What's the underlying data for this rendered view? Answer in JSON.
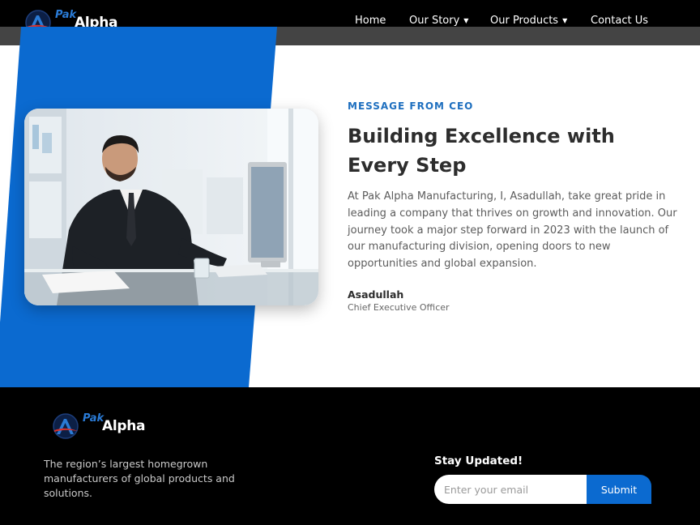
{
  "brand": {
    "word1": "Pak",
    "word2": "Alpha",
    "accent": "#0b6ad0"
  },
  "nav": {
    "items": [
      {
        "label": "Home",
        "has_dropdown": false
      },
      {
        "label": "Our Story",
        "has_dropdown": true
      },
      {
        "label": "Our Products",
        "has_dropdown": true
      },
      {
        "label": "Contact Us",
        "has_dropdown": false
      }
    ],
    "caret": "▼"
  },
  "hero": {
    "eyebrow": "MESSAGE FROM CEO",
    "headline": "Building Excellence with Every Step",
    "body": "At Pak Alpha Manufacturing, I, Asadullah, take great pride in leading a company that thrives on growth and innovation. Our journey took a major step forward in 2023 with the launch of our manufacturing division, opening doors to new opportunities and global expansion.",
    "ceo_name": "Asadullah",
    "ceo_title": "Chief Executive Officer",
    "photo_icon": "businessman-at-desk-photo"
  },
  "footer": {
    "tagline": "The region’s largest homegrown manufacturers of global products and solutions.",
    "newsletter_heading": "Stay Updated!",
    "email_placeholder": "Enter your email",
    "email_value": "",
    "submit_label": "Submit"
  }
}
